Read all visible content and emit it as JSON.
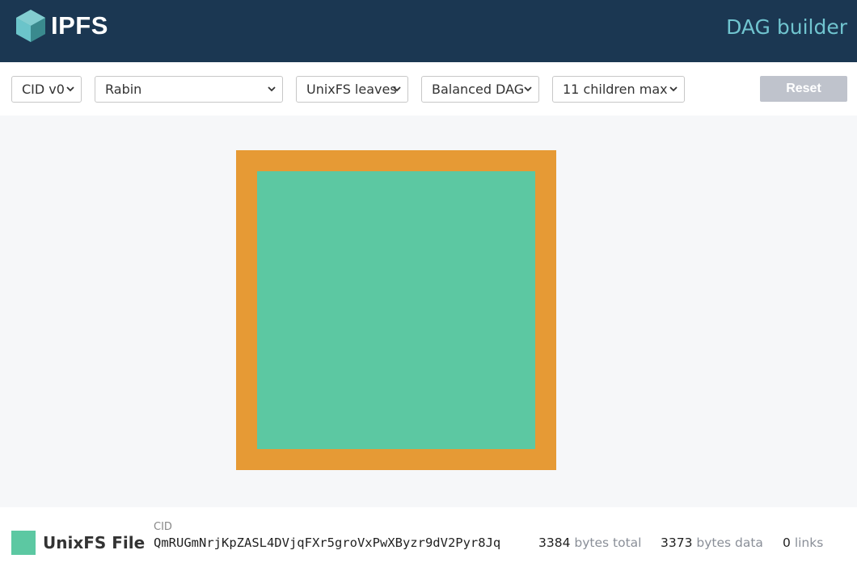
{
  "header": {
    "brand": "IPFS",
    "title": "DAG builder",
    "logo_icon": "ipfs-cube-logo"
  },
  "toolbar": {
    "cid_version": {
      "value": "CID v0"
    },
    "chunker": {
      "value": "Rabin"
    },
    "leaf_type": {
      "value": "UnixFS leaves"
    },
    "layout": {
      "value": "Balanced DAG"
    },
    "max_children": {
      "value": "11 children max"
    },
    "reset_label": "Reset"
  },
  "colors": {
    "header_bg": "#1b3752",
    "title": "#70c4cf",
    "node_border": "#e69a35",
    "unixfs_file": "#5cc8a2",
    "canvas_bg": "#f6f7f9",
    "reset_disabled": "#bfc3cc"
  },
  "details": {
    "node_type": "UnixFS File",
    "cid_label": "CID",
    "cid": "QmRUGmNrjKpZASL4DVjqFXr5groVxPwXByzr9dV2Pyr8Jq",
    "bytes_total": "3384",
    "bytes_total_unit": "bytes total",
    "bytes_data": "3373",
    "bytes_data_unit": "bytes data",
    "links": "0",
    "links_unit": "links"
  }
}
